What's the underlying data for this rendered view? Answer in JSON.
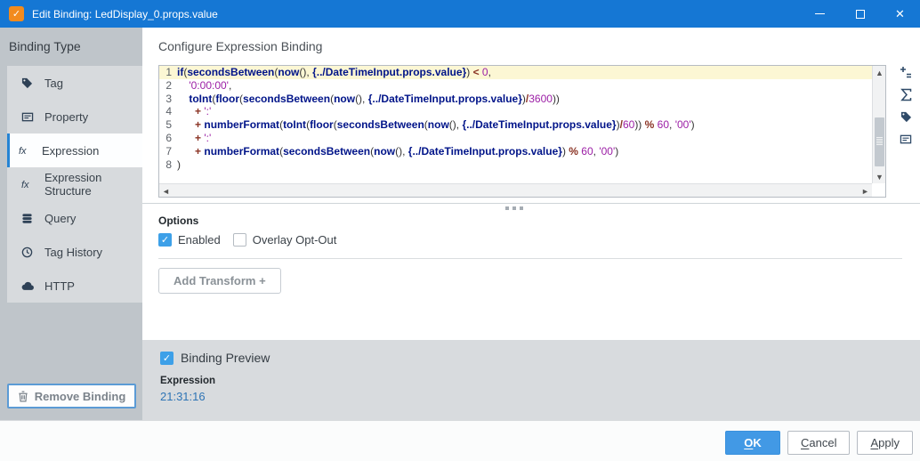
{
  "window": {
    "title": "Edit Binding: LedDisplay_0.props.value",
    "icon": "binding-icon",
    "controls": [
      "minimize",
      "maximize",
      "close"
    ]
  },
  "colors": {
    "titlebar": "#1577d4",
    "title_icon": "#f28b1e",
    "accent_blue": "#2584d4",
    "checkbox_blue": "#3da0e8",
    "ok_button": "#4299e5",
    "code_keyword": "#001489",
    "code_string": "#9c1fa6",
    "code_operator": "#8a3324",
    "current_line_highlight": "#fcf7d4",
    "preview_value_blue": "#2e74b5"
  },
  "sidebar": {
    "header": "Binding Type",
    "items": [
      {
        "label": "Tag",
        "icon": "tag-icon",
        "selected": false
      },
      {
        "label": "Property",
        "icon": "property-icon",
        "selected": false
      },
      {
        "label": "Expression",
        "icon": "fx-icon",
        "selected": true
      },
      {
        "label": "Expression Structure",
        "icon": "fx-icon",
        "selected": false
      },
      {
        "label": "Query",
        "icon": "database-icon",
        "selected": false
      },
      {
        "label": "Tag History",
        "icon": "clock-icon",
        "selected": false
      },
      {
        "label": "HTTP",
        "icon": "cloud-icon",
        "selected": false
      }
    ],
    "remove_button_label": "Remove Binding",
    "remove_button_icon": "trash-icon"
  },
  "main": {
    "heading": "Configure Expression Binding",
    "editor": {
      "lines": [
        {
          "num": "1",
          "highlight": true,
          "tokens": [
            [
              "fn",
              "if"
            ],
            [
              "pl",
              "("
            ],
            [
              "fn",
              "secondsBetween"
            ],
            [
              "pl",
              "("
            ],
            [
              "fn",
              "now"
            ],
            [
              "pl",
              "(), "
            ],
            [
              "ref",
              "{../DateTimeInput.props.value}"
            ],
            [
              "pl",
              ") "
            ],
            [
              "op",
              "<"
            ],
            [
              "pl",
              " "
            ],
            [
              "num",
              "0"
            ],
            [
              "pl",
              ","
            ]
          ]
        },
        {
          "num": "2",
          "highlight": false,
          "tokens": [
            [
              "pl",
              "    "
            ],
            [
              "str",
              "'0:00:00'"
            ],
            [
              "pl",
              ","
            ]
          ]
        },
        {
          "num": "3",
          "highlight": false,
          "tokens": [
            [
              "pl",
              "    "
            ],
            [
              "fn",
              "toInt"
            ],
            [
              "pl",
              "("
            ],
            [
              "fn",
              "floor"
            ],
            [
              "pl",
              "("
            ],
            [
              "fn",
              "secondsBetween"
            ],
            [
              "pl",
              "("
            ],
            [
              "fn",
              "now"
            ],
            [
              "pl",
              "(), "
            ],
            [
              "ref",
              "{../DateTimeInput.props.value}"
            ],
            [
              "pl",
              ")"
            ],
            [
              "op",
              "/"
            ],
            [
              "num",
              "3600"
            ],
            [
              "pl",
              "))"
            ]
          ]
        },
        {
          "num": "4",
          "highlight": false,
          "tokens": [
            [
              "pl",
              "      "
            ],
            [
              "op",
              "+"
            ],
            [
              "pl",
              " "
            ],
            [
              "str",
              "':'"
            ]
          ]
        },
        {
          "num": "5",
          "highlight": false,
          "tokens": [
            [
              "pl",
              "      "
            ],
            [
              "op",
              "+"
            ],
            [
              "pl",
              " "
            ],
            [
              "fn",
              "numberFormat"
            ],
            [
              "pl",
              "("
            ],
            [
              "fn",
              "toInt"
            ],
            [
              "pl",
              "("
            ],
            [
              "fn",
              "floor"
            ],
            [
              "pl",
              "("
            ],
            [
              "fn",
              "secondsBetween"
            ],
            [
              "pl",
              "("
            ],
            [
              "fn",
              "now"
            ],
            [
              "pl",
              "(), "
            ],
            [
              "ref",
              "{../DateTimeInput.props.value}"
            ],
            [
              "pl",
              ")"
            ],
            [
              "op",
              "/"
            ],
            [
              "num",
              "60"
            ],
            [
              "pl",
              ")) "
            ],
            [
              "op",
              "%"
            ],
            [
              "pl",
              " "
            ],
            [
              "num",
              "60"
            ],
            [
              "pl",
              ", "
            ],
            [
              "str",
              "'00'"
            ],
            [
              "pl",
              ")"
            ]
          ]
        },
        {
          "num": "6",
          "highlight": false,
          "tokens": [
            [
              "pl",
              "      "
            ],
            [
              "op",
              "+"
            ],
            [
              "pl",
              " "
            ],
            [
              "str",
              "':'"
            ]
          ]
        },
        {
          "num": "7",
          "highlight": false,
          "tokens": [
            [
              "pl",
              "      "
            ],
            [
              "op",
              "+"
            ],
            [
              "pl",
              " "
            ],
            [
              "fn",
              "numberFormat"
            ],
            [
              "pl",
              "("
            ],
            [
              "fn",
              "secondsBetween"
            ],
            [
              "pl",
              "("
            ],
            [
              "fn",
              "now"
            ],
            [
              "pl",
              "(), "
            ],
            [
              "ref",
              "{../DateTimeInput.props.value}"
            ],
            [
              "pl",
              ") "
            ],
            [
              "op",
              "%"
            ],
            [
              "pl",
              " "
            ],
            [
              "num",
              "60"
            ],
            [
              "pl",
              ", "
            ],
            [
              "str",
              "'00'"
            ],
            [
              "pl",
              ")"
            ]
          ]
        },
        {
          "num": "8",
          "highlight": false,
          "tokens": [
            [
              "pl",
              ")"
            ]
          ]
        }
      ],
      "tools": [
        {
          "icon": "insert-operator-icon"
        },
        {
          "icon": "insert-function-icon"
        },
        {
          "icon": "insert-tag-icon"
        },
        {
          "icon": "insert-property-icon"
        }
      ]
    },
    "options": {
      "label": "Options",
      "checkboxes": [
        {
          "label": "Enabled",
          "checked": true
        },
        {
          "label": "Overlay Opt-Out",
          "checked": false
        }
      ]
    },
    "add_transform_label": "Add Transform +"
  },
  "preview": {
    "checked": true,
    "checkbox_label": "Binding Preview",
    "field_label": "Expression",
    "value": "21:31:16"
  },
  "footer": {
    "buttons": [
      {
        "label": "OK",
        "mnemonic": "O",
        "primary": true
      },
      {
        "label": "Cancel",
        "mnemonic": "C",
        "primary": false
      },
      {
        "label": "Apply",
        "mnemonic": "A",
        "primary": false
      }
    ]
  }
}
